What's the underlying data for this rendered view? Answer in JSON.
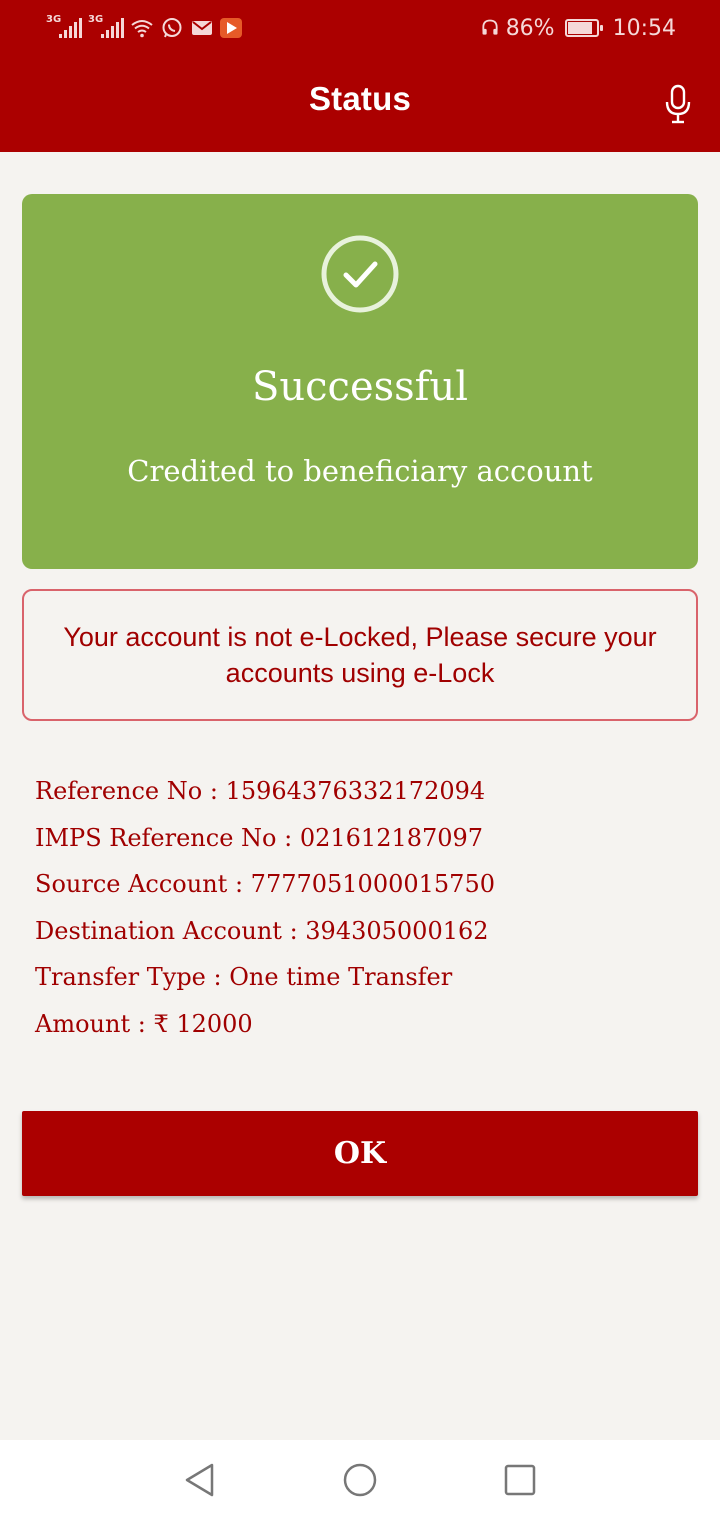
{
  "status_bar": {
    "network_1": "3G",
    "network_2": "3G",
    "battery": "86%",
    "battery_level": 0.86,
    "time": "10:54"
  },
  "header": {
    "title": "Status",
    "mic_icon": "microphone-icon"
  },
  "success_card": {
    "icon": "check-circle-icon",
    "title": "Successful",
    "subtitle": "Credited to beneficiary account",
    "color": "#87b04b"
  },
  "elock_notice": {
    "text": "Your account is not e-Locked, Please secure your accounts using e-Lock"
  },
  "details": [
    {
      "label": "Reference No",
      "value": "15964376332172094"
    },
    {
      "label": "IMPS Reference No",
      "value": "021612187097"
    },
    {
      "label": "Source Account",
      "value": "7777051000015750"
    },
    {
      "label": "Destination Account",
      "value": "394305000162"
    },
    {
      "label": "Transfer Type",
      "value": "One time Transfer"
    },
    {
      "label": "Amount",
      "value": "₹ 12000"
    }
  ],
  "ok_button": {
    "label": "OK"
  },
  "nav_bar": {
    "back_icon": "back-triangle-icon",
    "home_icon": "home-circle-icon",
    "recents_icon": "recents-square-icon"
  },
  "colors": {
    "brand": "#ab0000",
    "text_accent": "#a00000",
    "background": "#f5f3f0"
  }
}
